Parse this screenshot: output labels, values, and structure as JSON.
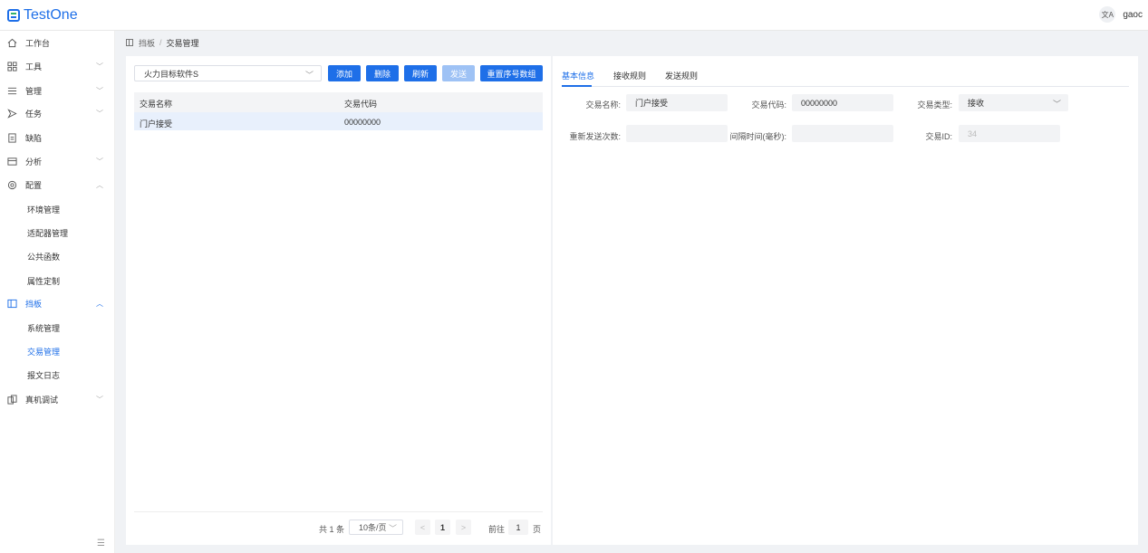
{
  "header": {
    "app_name": "TestOne",
    "lang_icon": "translate-icon",
    "lang_glyph": "文A",
    "user": "gaoc"
  },
  "sidebar": {
    "items": [
      {
        "label": "工作台",
        "icon": "home-icon"
      },
      {
        "label": "工具",
        "icon": "grid-icon"
      },
      {
        "label": "管理",
        "icon": "list-icon"
      },
      {
        "label": "任务",
        "icon": "send-icon"
      },
      {
        "label": "缺陷",
        "icon": "document-icon"
      },
      {
        "label": "分析",
        "icon": "chart-icon"
      },
      {
        "label": "配置",
        "icon": "gear-icon"
      },
      {
        "label": "挡板",
        "icon": "panel-icon"
      },
      {
        "label": "真机调试",
        "icon": "device-icon"
      }
    ],
    "config_children": [
      "环境管理",
      "适配器管理",
      "公共函数",
      "属性定制"
    ],
    "baffle_children": [
      "系统管理",
      "交易管理",
      "报文日志"
    ],
    "collapse_glyph": "☰"
  },
  "breadcrumb": {
    "parent": "挡板",
    "separator": "/",
    "current": "交易管理"
  },
  "left_panel": {
    "system_select": "火力目标软件S",
    "buttons": {
      "add": "添加",
      "delete": "删除",
      "refresh": "刷新",
      "send": "发送",
      "reset": "重置序号数组"
    },
    "table": {
      "headers": [
        "交易名称",
        "交易代码"
      ],
      "rows": [
        [
          "门户接受",
          "00000000"
        ]
      ]
    },
    "pager": {
      "total": "共 1 条",
      "page_size": "10条/页",
      "prev": "<",
      "current": "1",
      "next": ">",
      "goto": "前往",
      "goto_value": "1",
      "page_unit": "页"
    }
  },
  "right_panel": {
    "tabs": [
      "基本信息",
      "接收规则",
      "发送规则"
    ],
    "form": {
      "name_label": "交易名称:",
      "name_value": "门户接受",
      "code_label": "交易代码:",
      "code_value": "00000000",
      "type_label": "交易类型:",
      "type_value": "接收",
      "resend_label": "重新发送次数:",
      "resend_value": "",
      "interval_label": "间隔时间(毫秒):",
      "interval_value": "",
      "id_label": "交易ID:",
      "id_value": "34"
    }
  },
  "colors": {
    "primary": "#1e6fe8",
    "disabled": "#9ec2f5",
    "selected_row": "#e8f0fc"
  }
}
